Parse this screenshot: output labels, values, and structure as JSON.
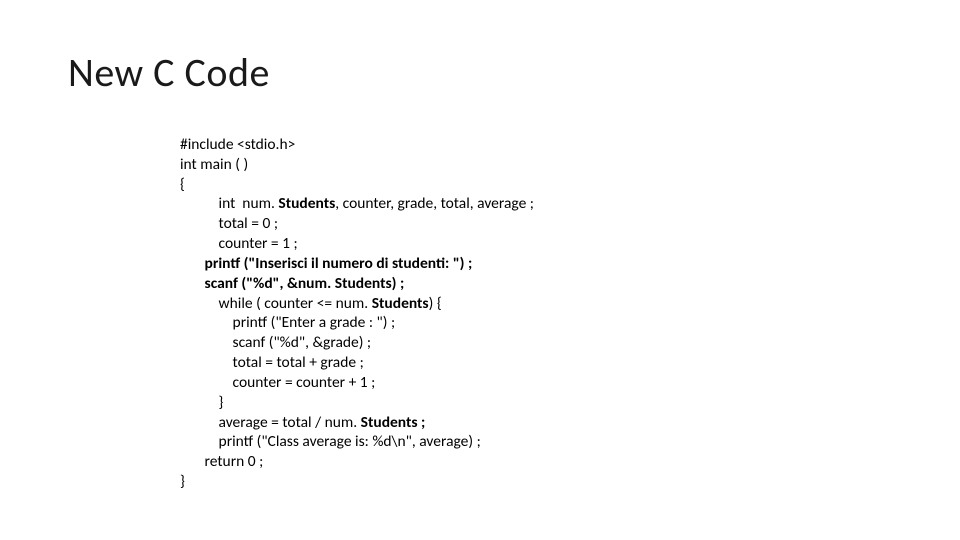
{
  "title": "New C Code",
  "code": {
    "l01": "#include <stdio.h>",
    "l02": "int main ( )",
    "l03": "{",
    "l04_a": "           int  num. ",
    "l04_b": "Students",
    "l04_c": ", counter, grade, total, average ;",
    "l05": "           total = 0 ;",
    "l06": "           counter = 1 ;",
    "l07_a": "       printf (\"Inserisci",
    "l07_b": " il numero di studenti",
    "l07_c": ": \") ;",
    "l08_a": "       scanf (\"%d\", &num. ",
    "l08_b": "Students) ;",
    "l09_a": "           while ( counter <= num. ",
    "l09_b": "Students",
    "l09_c": ") {",
    "l10": "               printf (\"Enter a grade : \") ;",
    "l11": "               scanf (\"%d\", &grade) ;",
    "l12": "               total = total + grade ;",
    "l13": "               counter = counter + 1 ;",
    "l14": "           }",
    "l15_a": "           average = total / num. ",
    "l15_b": "Students ;",
    "l16": "           printf (\"Class average is: %d\\n\", average) ;",
    "l17": "       return 0 ;",
    "l18": "}"
  }
}
